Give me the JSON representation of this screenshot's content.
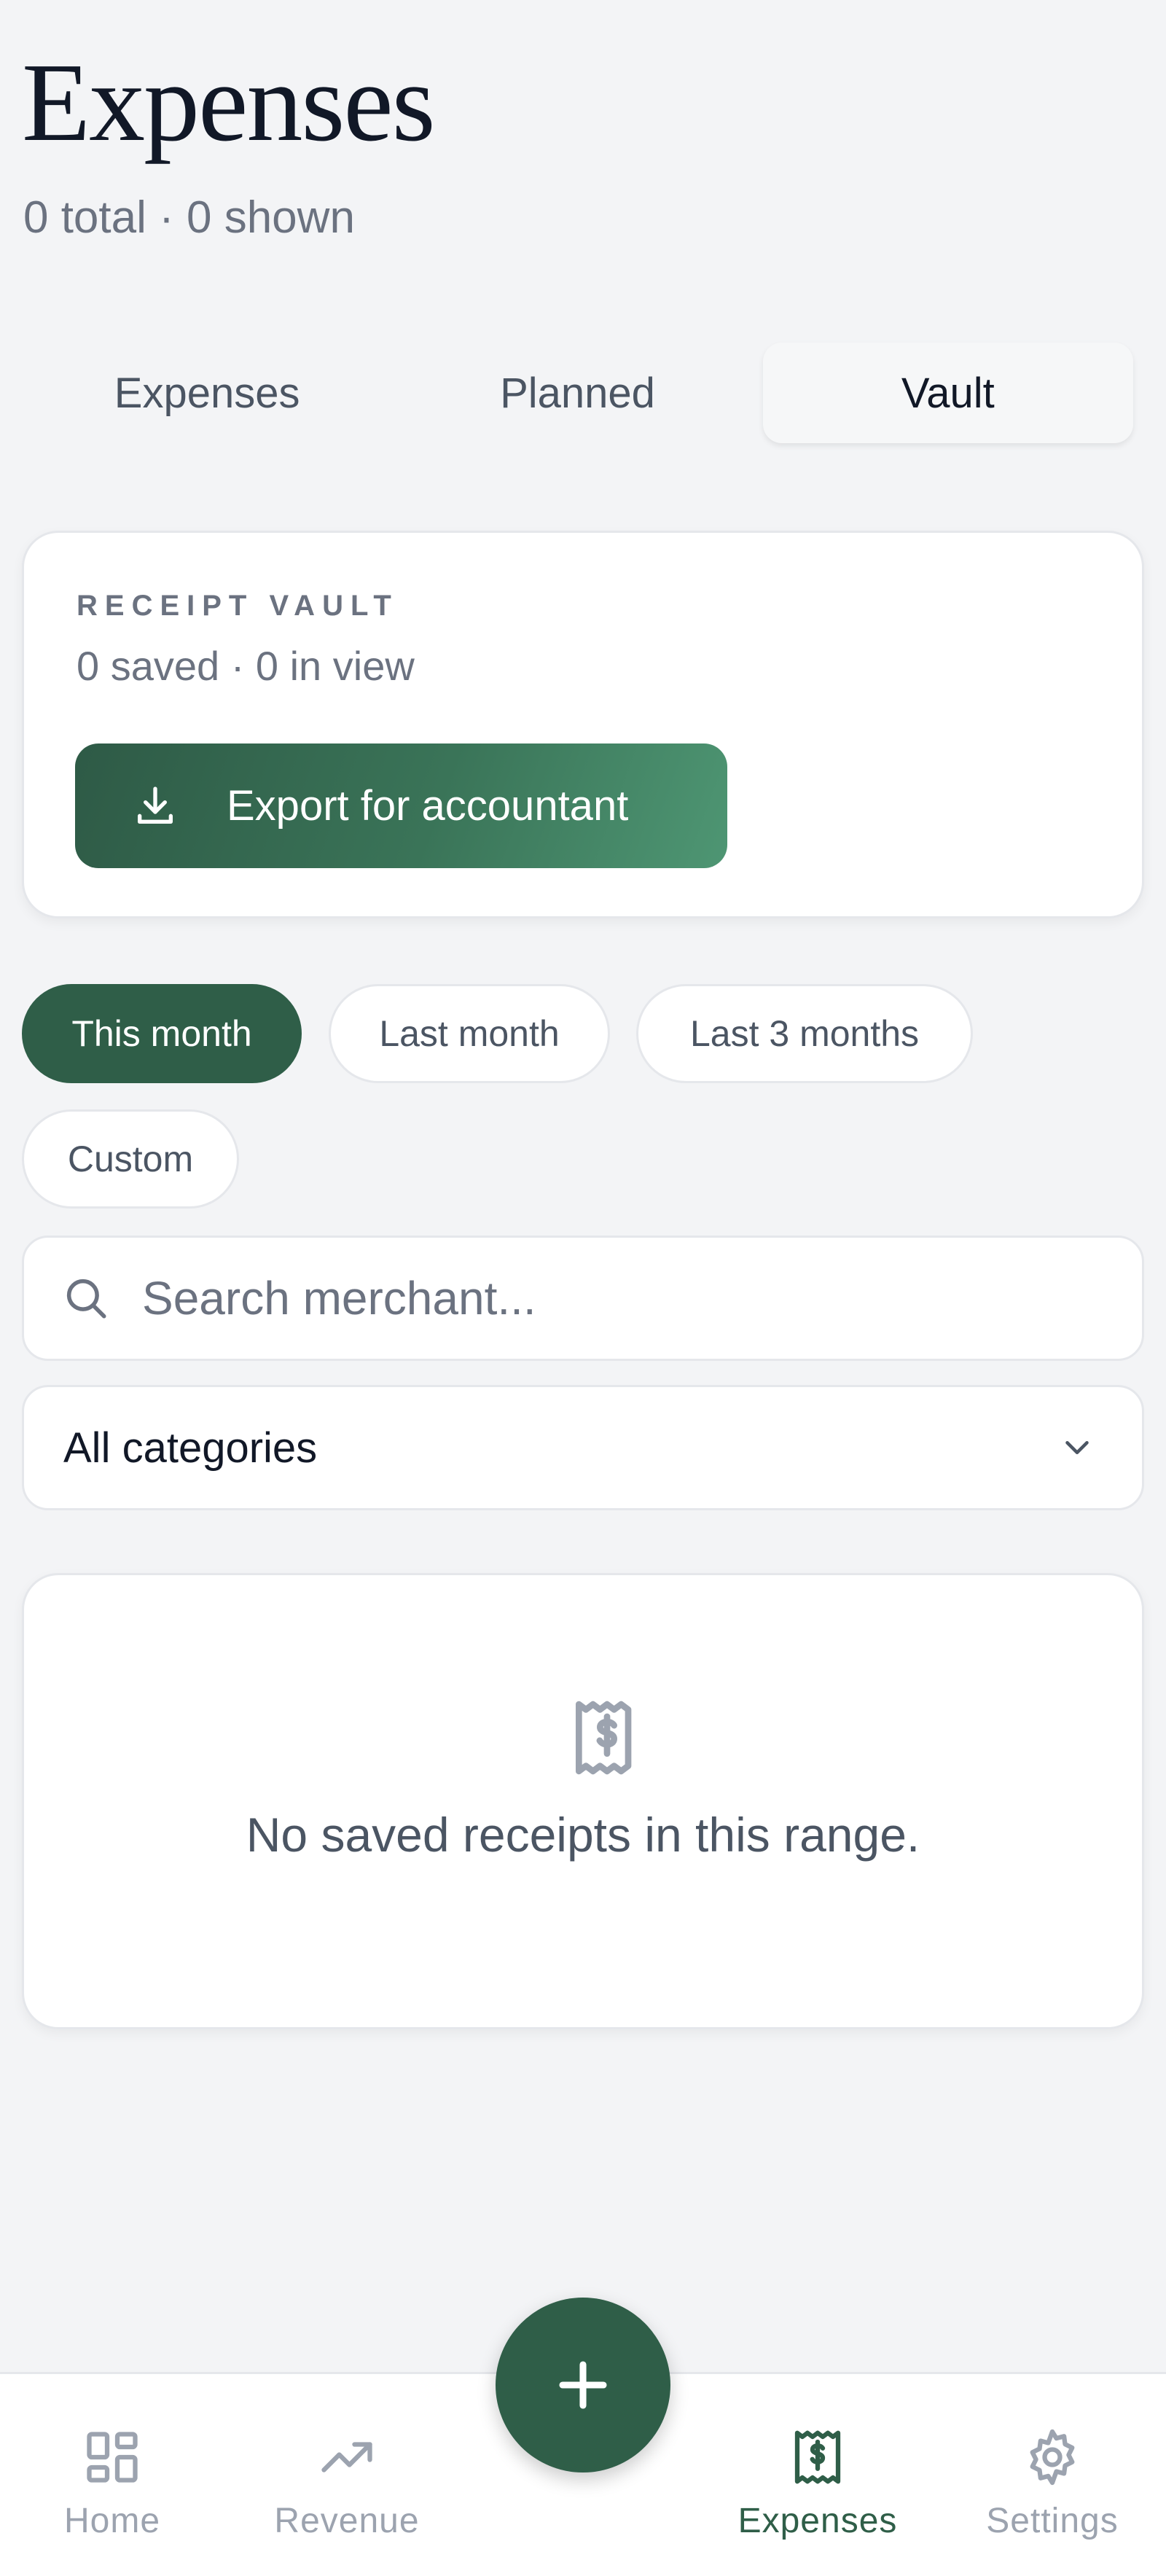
{
  "header": {
    "title": "Expenses",
    "subtitle": "0 total · 0 shown"
  },
  "tabs": [
    {
      "label": "Expenses",
      "active": false
    },
    {
      "label": "Planned",
      "active": false
    },
    {
      "label": "Vault",
      "active": true
    }
  ],
  "vault": {
    "label": "RECEIPT VAULT",
    "count": "0 saved · 0 in view",
    "export_label": "Export for accountant",
    "export_icon": "download-icon"
  },
  "range_filters": [
    {
      "label": "This month",
      "active": true
    },
    {
      "label": "Last month",
      "active": false
    },
    {
      "label": "Last 3 months",
      "active": false
    },
    {
      "label": "Custom",
      "active": false
    }
  ],
  "search": {
    "placeholder": "Search merchant...",
    "value": "",
    "icon": "search-icon"
  },
  "category_select": {
    "value": "All categories",
    "icon": "chevron-down-icon"
  },
  "empty_state": {
    "icon": "receipt-icon",
    "message": "No saved receipts in this range."
  },
  "nav": [
    {
      "label": "Home",
      "icon": "grid-icon",
      "active": false
    },
    {
      "label": "Revenue",
      "icon": "trending-up-icon",
      "active": false
    },
    {
      "label": "Expenses",
      "icon": "receipt-icon",
      "active": true
    },
    {
      "label": "Settings",
      "icon": "gear-icon",
      "active": false
    }
  ],
  "fab": {
    "icon": "plus-icon"
  },
  "colors": {
    "accent": "#2f5e48",
    "background": "#f3f4f6",
    "muted_text": "#6b7280"
  }
}
